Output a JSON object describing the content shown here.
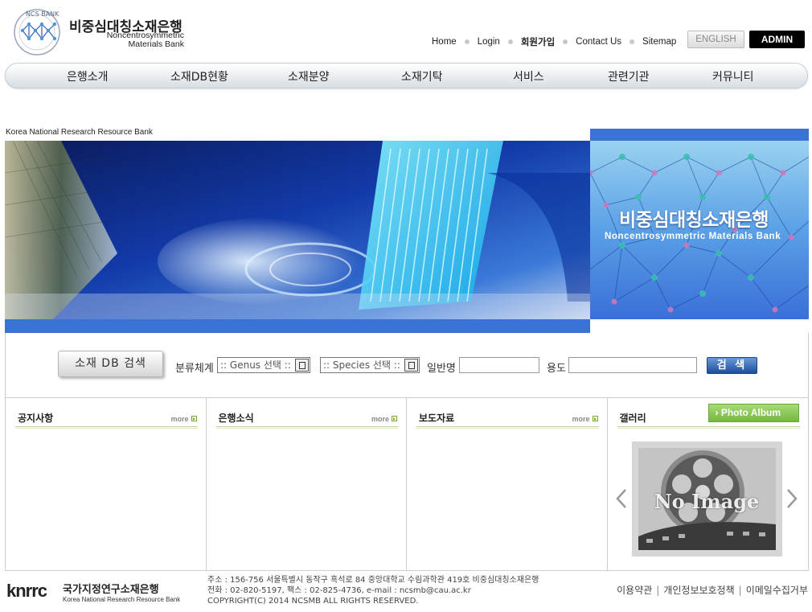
{
  "header": {
    "logo_title": "비중심대칭소재은행",
    "logo_sub_line1": "Noncentrosymmetric",
    "logo_sub_line2": "Materials Bank",
    "logo_badge": "NCS BANK",
    "top_links": [
      "Home",
      "Login",
      "회원가입",
      "Contact Us",
      "Sitemap"
    ],
    "english_label": "ENGLISH",
    "admin_label": "ADMIN"
  },
  "main_nav": [
    "은행소개",
    "소재DB현황",
    "소재분양",
    "소재기탁",
    "서비스",
    "관련기관",
    "커뮤니티"
  ],
  "banner": {
    "caption": "Korea National Research Resource Bank",
    "bank_name": "비중심대칭소재은행",
    "bank_sub": "Noncentrosymmetric Materials Bank"
  },
  "search": {
    "title_button": "소재 DB 검색",
    "classification_label": "분류체계",
    "genus_select": ":: Genus 선택 ::",
    "species_select": ":: Species 선택 ::",
    "common_name_label": "일반명",
    "common_name_value": "",
    "usage_label": "용도",
    "usage_value": "",
    "submit_label": "검 색"
  },
  "boards": [
    {
      "title": "공지사항",
      "more": "more"
    },
    {
      "title": "은행소식",
      "more": "more"
    },
    {
      "title": "보도자료",
      "more": "more"
    },
    {
      "title": "갤러리",
      "album": "Photo Album",
      "no_image": "No Image"
    }
  ],
  "footer": {
    "logo_text": "knrrc",
    "org_ko": "국가지정연구소재은행",
    "org_en": "Korea National Research Resource Bank",
    "address": "주소 : 156-756 서울특별시 동작구 흑석로 84 중앙대학교 수림과학관 419호 비중심대칭소재은행",
    "contact": "전화 : 02-820-5197, 팩스 : 02-825-4736, e-mail : ncsmb@cau.ac.kr",
    "copyright": "COPYRIGHT(C) 2014 NCSMB ALL RIGHTS RESERVED.",
    "links": [
      "이용약관",
      "개인정보보호정책",
      "이메일수집거부"
    ]
  },
  "colors": {
    "accent_blue": "#3a72d6",
    "green": "#7aa82f",
    "search_button": "#1f4f9c"
  }
}
